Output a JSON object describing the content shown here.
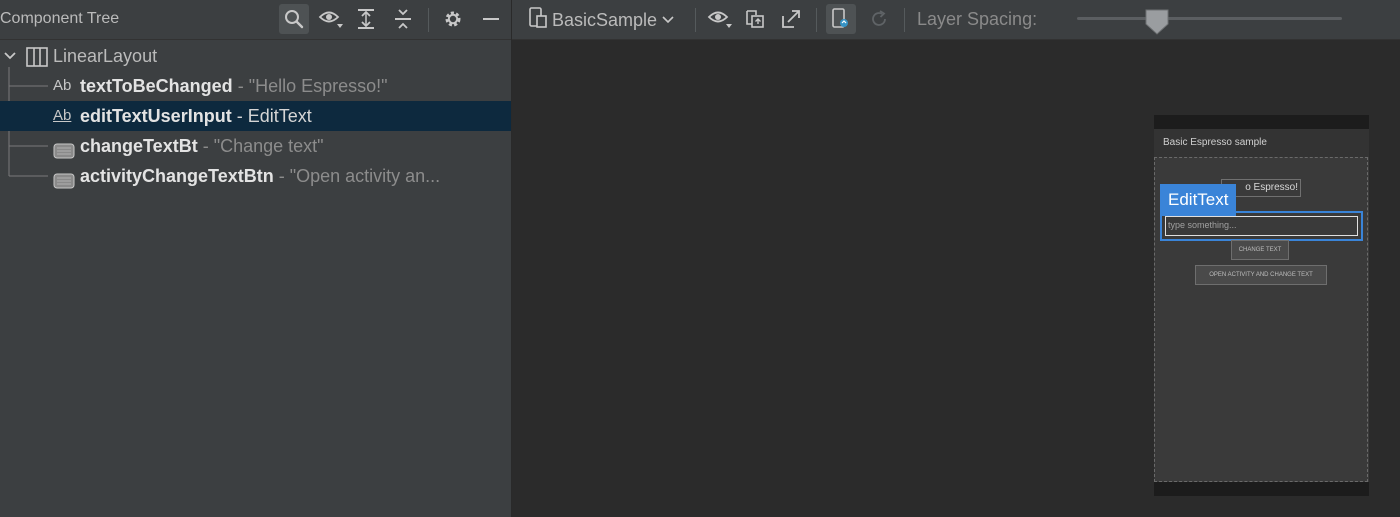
{
  "left_panel": {
    "title": "Component Tree",
    "toolbar_icons": [
      "search-icon",
      "eye-icon",
      "expand-all-icon",
      "collapse-all-icon",
      "gear-icon",
      "minimize-icon"
    ]
  },
  "tree": {
    "root": {
      "label": "LinearLayout",
      "icon": "linear-layout-icon"
    },
    "children": [
      {
        "name": "textToBeChanged",
        "separator": " - ",
        "value": "\"Hello Espresso!\"",
        "icon": "textview-icon",
        "icon_text": "Ab",
        "selected": false
      },
      {
        "name": "editTextUserInput",
        "separator": " - ",
        "value": "EditText",
        "icon": "edittext-icon",
        "icon_text": "Ab",
        "selected": true
      },
      {
        "name": "changeTextBt",
        "separator": " - ",
        "value": "\"Change text\"",
        "icon": "button-icon",
        "selected": false
      },
      {
        "name": "activityChangeTextBtn",
        "separator": " - ",
        "value": "\"Open activity an...",
        "icon": "button-icon",
        "selected": false
      }
    ]
  },
  "inspector": {
    "device": "BasicSample",
    "layer_spacing_label": "Layer Spacing:",
    "layer_spacing_fraction": 0.3,
    "toolbar_icons": [
      "device-icon",
      "eye-icon",
      "export-icon",
      "expand-icon",
      "live-update-icon",
      "refresh-icon"
    ]
  },
  "phone": {
    "app_title": "Basic Espresso sample",
    "hello_text": "o Espresso!",
    "selected_label": "EditText",
    "edit_hint": "type something...",
    "change_text_btn": "CHANGE TEXT",
    "open_activity_btn": "OPEN ACTIVITY AND CHANGE TEXT"
  },
  "colors": {
    "selection_bg": "#0d293e",
    "highlight_blue": "#3a84d8",
    "panel_bg": "#3c3f41",
    "canvas_bg": "#2b2b2b"
  }
}
